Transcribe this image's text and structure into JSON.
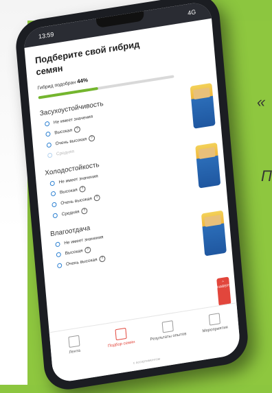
{
  "status": {
    "time": "13:59",
    "signal": "4G"
  },
  "header": {
    "title": "Подберите свой гибрид семян"
  },
  "progress": {
    "label": "Гибрид подобран",
    "value_text": "44%",
    "value": 0.44
  },
  "groups": [
    {
      "title": "Засухоустойчивость",
      "options": [
        "Не имеет значения",
        "Высокая",
        "Очень высокая",
        "Средняя"
      ]
    },
    {
      "title": "Холодостойкость",
      "options": [
        "Не имеет значения",
        "Высокая",
        "Очень высокая",
        "Средняя"
      ]
    },
    {
      "title": "Влагоотдача",
      "options": [
        "Не имеет значения",
        "Высокая",
        "Очень высокая"
      ]
    }
  ],
  "nav": {
    "items": [
      "Лента",
      "Подбор семян",
      "Результаты опытов",
      "Мероприятия"
    ],
    "footer": "с ассортиментом",
    "up_label": "НАВЕРХ"
  },
  "side": {
    "mark1": "«",
    "mark2": "П"
  },
  "colors": {
    "accent_green": "#74b62e",
    "radio_blue": "#2a7fd1",
    "accent_red": "#e2463c",
    "bg_green": "#8ec73f"
  }
}
